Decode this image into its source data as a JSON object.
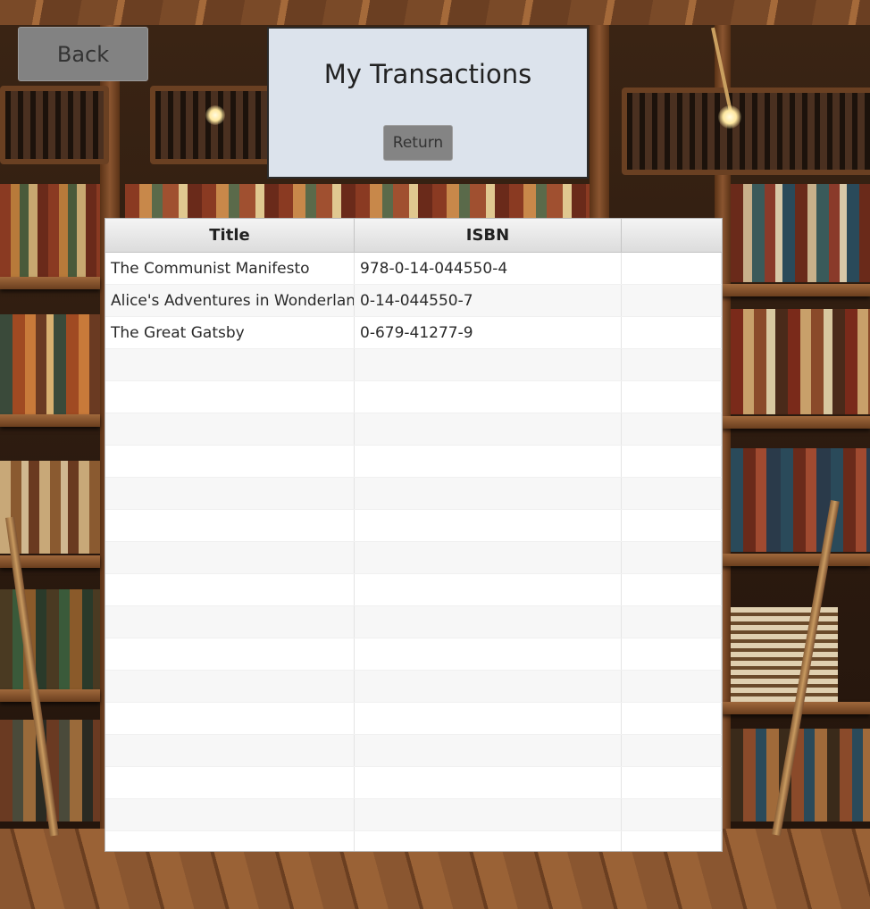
{
  "back_button": {
    "label": "Back"
  },
  "header": {
    "title": "My Transactions",
    "return_label": "Return"
  },
  "table": {
    "columns": [
      "Title",
      "ISBN",
      ""
    ],
    "rows": [
      {
        "title": "The Communist Manifesto",
        "isbn": "978-0-14-044550-4"
      },
      {
        "title": "Alice's Adventures in Wonderland",
        "isbn": "0-14-044550-7"
      },
      {
        "title": "The Great Gatsby",
        "isbn": "0-679-41277-9"
      }
    ],
    "empty_row_count": 16
  },
  "colors": {
    "header_panel_bg": "#dce3ec",
    "button_bg": "#828282",
    "table_bg": "#ffffff",
    "table_row_alt": "#f7f7f7"
  },
  "background": {
    "icon": "library-bookshelves-illustration"
  }
}
